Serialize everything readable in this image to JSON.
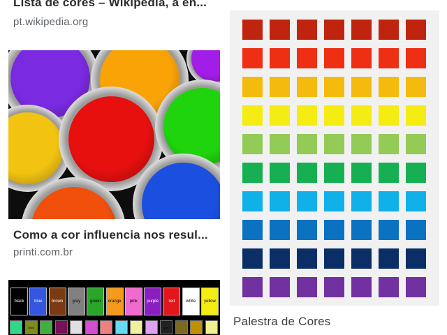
{
  "results": [
    {
      "title": "Lista de cores – Wikipédia, a en...",
      "source": "pt.wikipedia.org"
    },
    {
      "title": "Como a cor influencia nos resul...",
      "source": "printi.com.br"
    },
    {
      "title": "Palestra de Cores",
      "source": ""
    }
  ],
  "paint_cans": [
    {
      "color": "#7a2ae0"
    },
    {
      "color": "#f9a307"
    },
    {
      "color": "#a21ee8"
    },
    {
      "color": "#f2c311"
    },
    {
      "color": "#e8100f"
    },
    {
      "color": "#1fd40c"
    },
    {
      "color": "#f04f0c"
    },
    {
      "color": "#1b4fe0"
    }
  ],
  "palette_rows": [
    "#c0240e",
    "#ee2f14",
    "#f5ba0e",
    "#f4ec13",
    "#93cb56",
    "#16b053",
    "#10b0e9",
    "#0b71c1",
    "#0b2e66",
    "#7131a0"
  ],
  "named_colors": [
    {
      "label": "black",
      "color": "#000000"
    },
    {
      "label": "blue",
      "color": "#3456e0"
    },
    {
      "label": "brown",
      "color": "#7a3b12"
    },
    {
      "label": "gray",
      "color": "#808080"
    },
    {
      "label": "green",
      "color": "#2aa62a"
    },
    {
      "label": "orange",
      "color": "#f59a1a"
    },
    {
      "label": "pink",
      "color": "#f06ad0"
    },
    {
      "label": "purple",
      "color": "#8a1ec0"
    },
    {
      "label": "red",
      "color": "#e3161b"
    },
    {
      "label": "white",
      "color": "#ffffff"
    },
    {
      "label": "yellow",
      "color": "#f4ec13"
    }
  ],
  "named_colors_small": [
    {
      "label": "",
      "color": "#2fd98a"
    },
    {
      "label": "Olive",
      "color": "#7d8c1e"
    },
    {
      "label": "",
      "color": "#3fb03f"
    },
    {
      "label": "",
      "color": "#7a1058"
    },
    {
      "label": "",
      "color": "#e0e0e0"
    },
    {
      "label": "",
      "color": "#d24fd2"
    },
    {
      "label": "",
      "color": "#f08080"
    },
    {
      "label": "",
      "color": "#67d9f0"
    },
    {
      "label": "",
      "color": "#f0f0a0"
    },
    {
      "label": "",
      "color": "#e0a0f0"
    },
    {
      "label": "dark",
      "color": "#222222"
    },
    {
      "label": "",
      "color": "#7a6a22"
    },
    {
      "label": "",
      "color": "#c09000"
    },
    {
      "label": "",
      "color": "#f0f090"
    }
  ]
}
